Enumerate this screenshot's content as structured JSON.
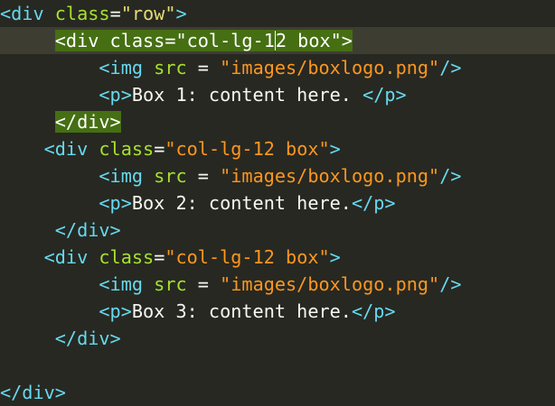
{
  "editor": {
    "lines": [
      {
        "indent": "",
        "parts": [
          {
            "text": "<div ",
            "cls": "t"
          },
          {
            "text": "class",
            "cls": "a"
          },
          {
            "text": "=",
            "cls": "p"
          },
          {
            "text": "\"row\"",
            "cls": "s"
          },
          {
            "text": ">",
            "cls": "t"
          }
        ]
      },
      {
        "indent": "     ",
        "current": true,
        "parts": [
          {
            "text": "<div class=\"col-lg-1",
            "cls": "hl"
          },
          {
            "cursor": true
          },
          {
            "text": "2 box\">",
            "cls": "hl"
          }
        ]
      },
      {
        "indent": "         ",
        "parts": [
          {
            "text": "<img ",
            "cls": "t"
          },
          {
            "text": "src",
            "cls": "a"
          },
          {
            "text": " = ",
            "cls": "p"
          },
          {
            "text": "\"images/boxlogo.png\"",
            "cls": "v"
          },
          {
            "text": "/>",
            "cls": "t"
          }
        ]
      },
      {
        "indent": "         ",
        "parts": [
          {
            "text": "<p>",
            "cls": "t"
          },
          {
            "text": "Box 1: content here. ",
            "cls": "p"
          },
          {
            "text": "</p>",
            "cls": "t"
          }
        ]
      },
      {
        "indent": "     ",
        "parts": [
          {
            "text": "</div>",
            "cls": "hl"
          }
        ]
      },
      {
        "indent": "    ",
        "parts": [
          {
            "text": "<div ",
            "cls": "t"
          },
          {
            "text": "class",
            "cls": "a"
          },
          {
            "text": "=",
            "cls": "p"
          },
          {
            "text": "\"col-lg-12 box\"",
            "cls": "v"
          },
          {
            "text": ">",
            "cls": "t"
          }
        ]
      },
      {
        "indent": "         ",
        "parts": [
          {
            "text": "<img ",
            "cls": "t"
          },
          {
            "text": "src",
            "cls": "a"
          },
          {
            "text": " = ",
            "cls": "p"
          },
          {
            "text": "\"images/boxlogo.png\"",
            "cls": "v"
          },
          {
            "text": "/>",
            "cls": "t"
          }
        ]
      },
      {
        "indent": "         ",
        "parts": [
          {
            "text": "<p>",
            "cls": "t"
          },
          {
            "text": "Box 2: content here.",
            "cls": "p"
          },
          {
            "text": "</p>",
            "cls": "t"
          }
        ]
      },
      {
        "indent": "     ",
        "parts": [
          {
            "text": "</div>",
            "cls": "t"
          }
        ]
      },
      {
        "indent": "    ",
        "parts": [
          {
            "text": "<div ",
            "cls": "t"
          },
          {
            "text": "class",
            "cls": "a"
          },
          {
            "text": "=",
            "cls": "p"
          },
          {
            "text": "\"col-lg-12 box\"",
            "cls": "v"
          },
          {
            "text": ">",
            "cls": "t"
          }
        ]
      },
      {
        "indent": "         ",
        "parts": [
          {
            "text": "<img ",
            "cls": "t"
          },
          {
            "text": "src",
            "cls": "a"
          },
          {
            "text": " = ",
            "cls": "p"
          },
          {
            "text": "\"images/boxlogo.png\"",
            "cls": "v"
          },
          {
            "text": "/>",
            "cls": "t"
          }
        ]
      },
      {
        "indent": "         ",
        "parts": [
          {
            "text": "<p>",
            "cls": "t"
          },
          {
            "text": "Box 3: content here.",
            "cls": "p"
          },
          {
            "text": "</p>",
            "cls": "t"
          }
        ]
      },
      {
        "indent": "     ",
        "parts": [
          {
            "text": "</div>",
            "cls": "t"
          }
        ]
      },
      {
        "indent": "",
        "parts": []
      },
      {
        "indent": "",
        "parts": [
          {
            "text": "</div>",
            "cls": "t"
          }
        ]
      }
    ]
  },
  "colors": {
    "background": "#272822",
    "current_line": "#3e3d32",
    "tag": "#66d9ef",
    "attribute": "#a6e22e",
    "string": "#fd971f",
    "text": "#f8f8f2",
    "match_highlight": "#456f12"
  }
}
